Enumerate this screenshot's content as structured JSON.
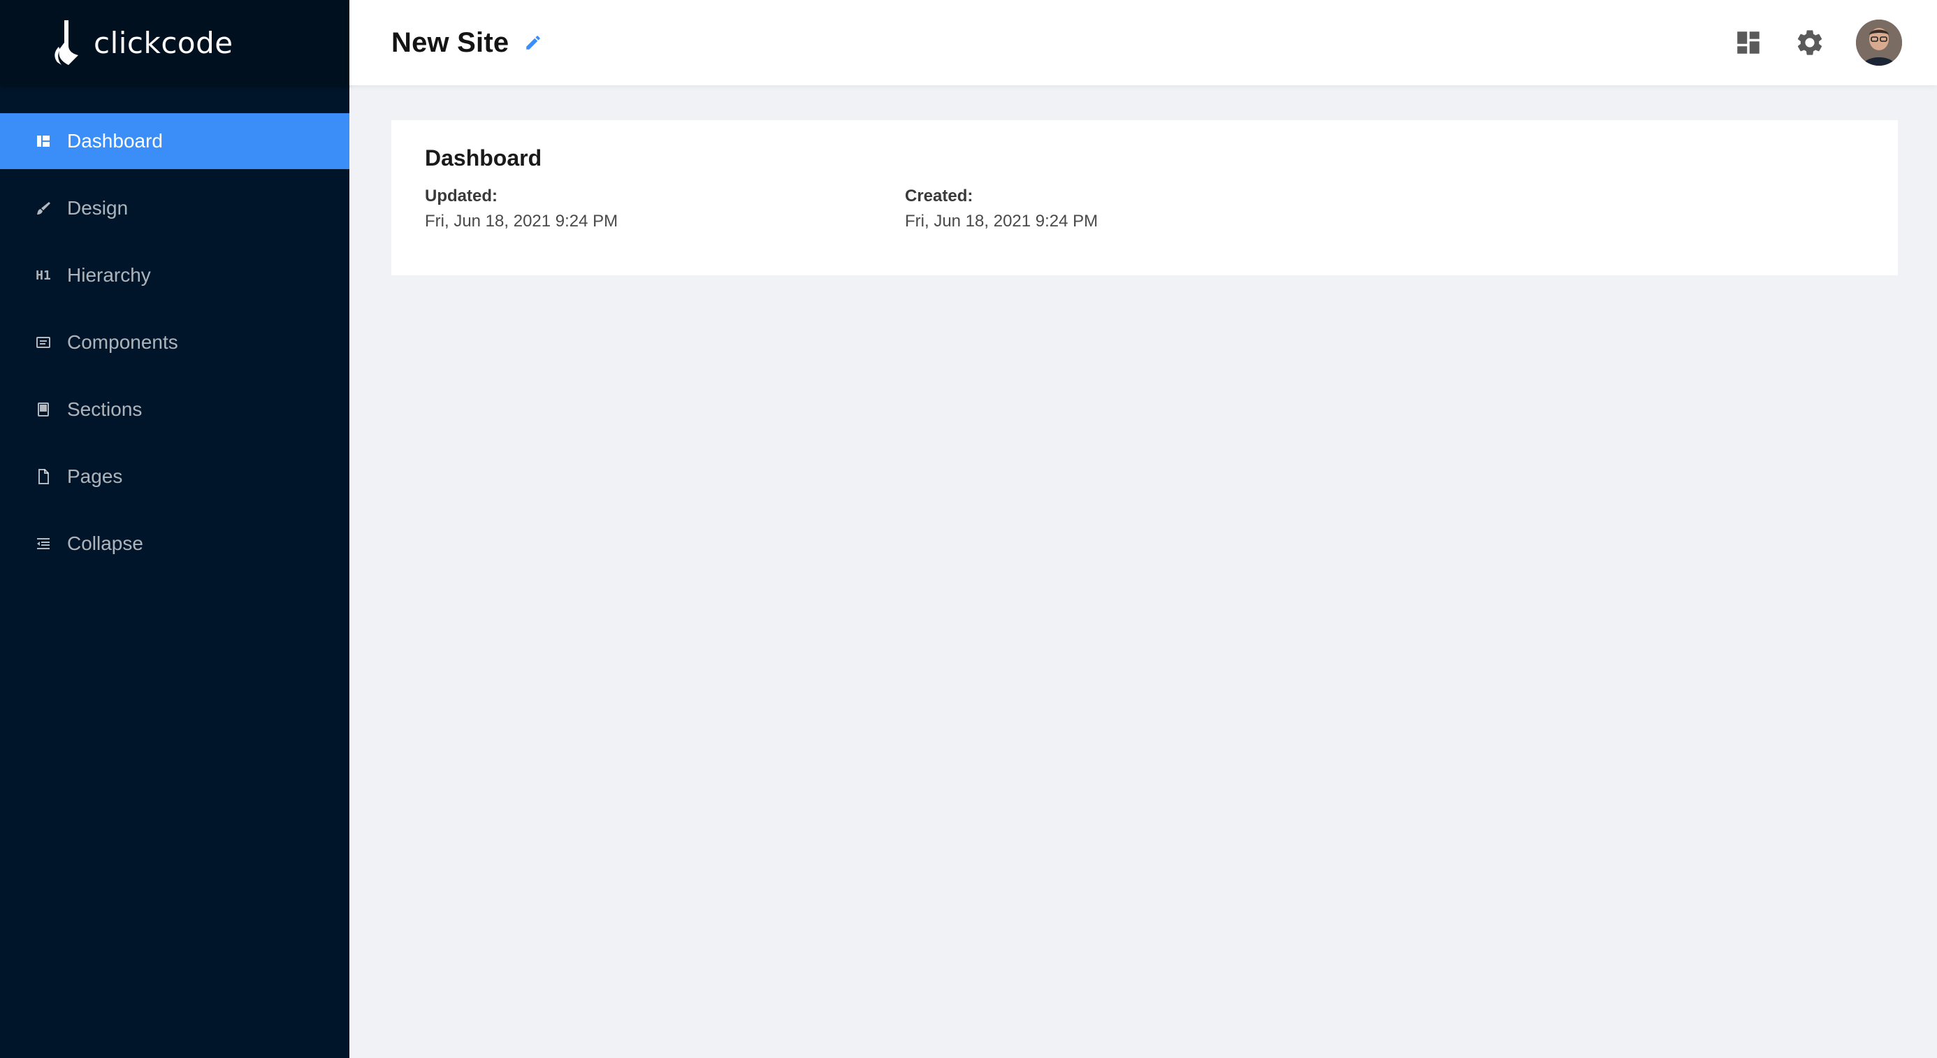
{
  "brand": {
    "name": "clickcode"
  },
  "sidebar": {
    "items": [
      {
        "label": "Dashboard",
        "icon": "dashboard-icon",
        "active": true
      },
      {
        "label": "Design",
        "icon": "brush-icon"
      },
      {
        "label": "Hierarchy",
        "icon": "h1-icon"
      },
      {
        "label": "Components",
        "icon": "components-icon"
      },
      {
        "label": "Sections",
        "icon": "sections-icon"
      },
      {
        "label": "Pages",
        "icon": "page-icon"
      },
      {
        "label": "Collapse",
        "icon": "collapse-icon"
      }
    ]
  },
  "header": {
    "title": "New Site",
    "icons": [
      "edit-icon",
      "layout-icon",
      "gear-icon",
      "avatar"
    ]
  },
  "card": {
    "title": "Dashboard",
    "updated_label": "Updated:",
    "updated_value": "Fri, Jun 18, 2021 9:24 PM",
    "created_label": "Created:",
    "created_value": "Fri, Jun 18, 2021 9:24 PM"
  },
  "colors": {
    "sidebar_bg": "#001529",
    "accent": "#3b8ef7",
    "content_bg": "#f0f2f5"
  },
  "sidebar_h1_glyph": "H1"
}
